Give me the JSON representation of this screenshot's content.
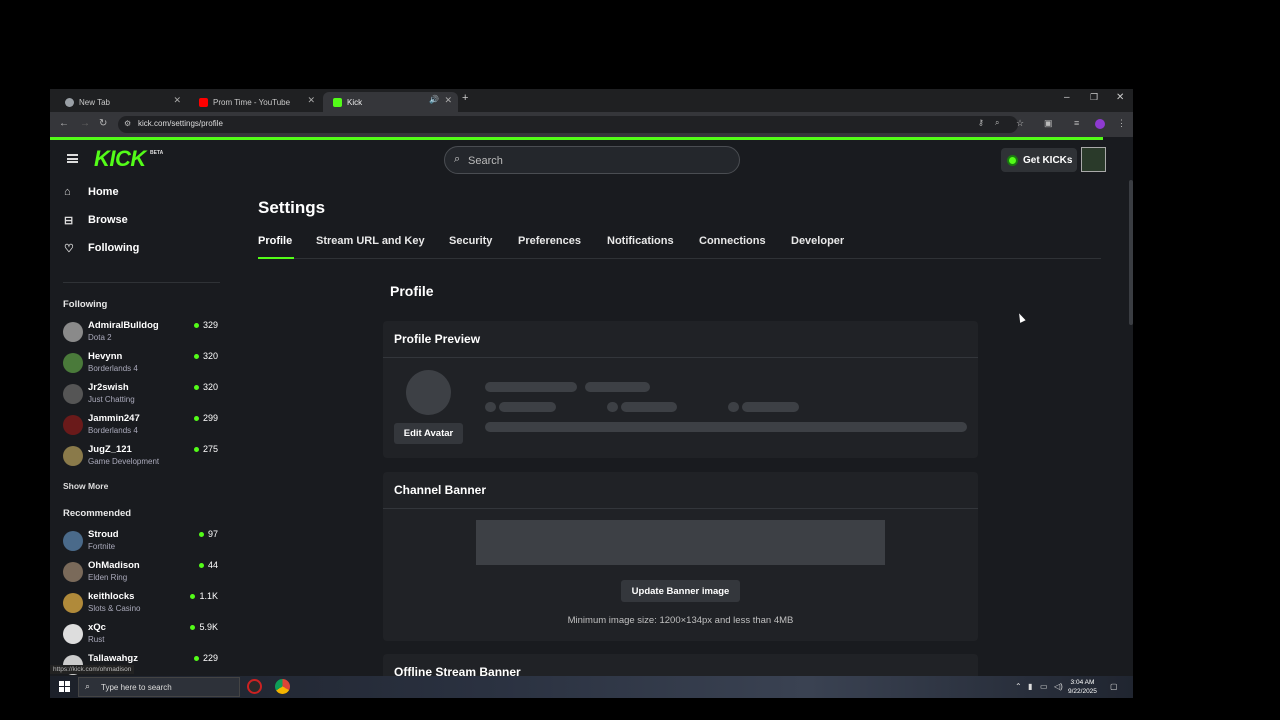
{
  "browser": {
    "tabs": [
      {
        "label": "New Tab",
        "favicon_color": "#9aa0a6"
      },
      {
        "label": "Prom Time - YouTube",
        "favicon_color": "#ff0000"
      },
      {
        "label": "Kick",
        "favicon_color": "#53fc18"
      }
    ],
    "url": "kick.com/settings/profile",
    "status_url": "https://kick.com/ohmadison"
  },
  "header": {
    "logo": "KICK",
    "logo_badge": "BETA",
    "search_placeholder": "Search",
    "get_kicks": "Get KICKs",
    "accent": "#53fc18"
  },
  "sidebar": {
    "nav": [
      {
        "label": "Home",
        "icon": "home-icon"
      },
      {
        "label": "Browse",
        "icon": "browse-icon"
      },
      {
        "label": "Following",
        "icon": "heart-icon"
      }
    ],
    "following_title": "Following",
    "following": [
      {
        "name": "AdmiralBulldog",
        "game": "Dota 2",
        "viewers": "329",
        "color": "#8a8a8a"
      },
      {
        "name": "Hevynn",
        "game": "Borderlands 4",
        "viewers": "320",
        "color": "#4a7a3a"
      },
      {
        "name": "Jr2swish",
        "game": "Just Chatting",
        "viewers": "320",
        "color": "#555"
      },
      {
        "name": "Jammin247",
        "game": "Borderlands 4",
        "viewers": "299",
        "color": "#6a1a1a"
      },
      {
        "name": "JugZ_121",
        "game": "Game Development",
        "viewers": "275",
        "color": "#8a7a4a"
      }
    ],
    "show_more": "Show More",
    "recommended_title": "Recommended",
    "recommended": [
      {
        "name": "Stroud",
        "game": "Fortnite",
        "viewers": "97",
        "color": "#4a6a8a"
      },
      {
        "name": "OhMadison",
        "game": "Elden Ring",
        "viewers": "44",
        "color": "#7a6a5a"
      },
      {
        "name": "keithlocks",
        "game": "Slots & Casino",
        "viewers": "1.1K",
        "color": "#b08a3a"
      },
      {
        "name": "xQc",
        "game": "Rust",
        "viewers": "5.9K",
        "color": "#ddd"
      },
      {
        "name": "Tallawahgz",
        "game": "",
        "viewers": "229",
        "color": "#ccc"
      }
    ]
  },
  "settings": {
    "title": "Settings",
    "tabs": [
      "Profile",
      "Stream URL and Key",
      "Security",
      "Preferences",
      "Notifications",
      "Connections",
      "Developer"
    ],
    "section_title": "Profile",
    "preview_title": "Profile Preview",
    "edit_avatar": "Edit Avatar",
    "banner_title": "Channel Banner",
    "update_banner": "Update Banner image",
    "banner_hint": "Minimum image size: 1200×134px and less than 4MB",
    "offline_title": "Offline Stream Banner"
  },
  "taskbar": {
    "search": "Type here to search",
    "time": "3:04 AM",
    "date": "9/22/2025"
  }
}
